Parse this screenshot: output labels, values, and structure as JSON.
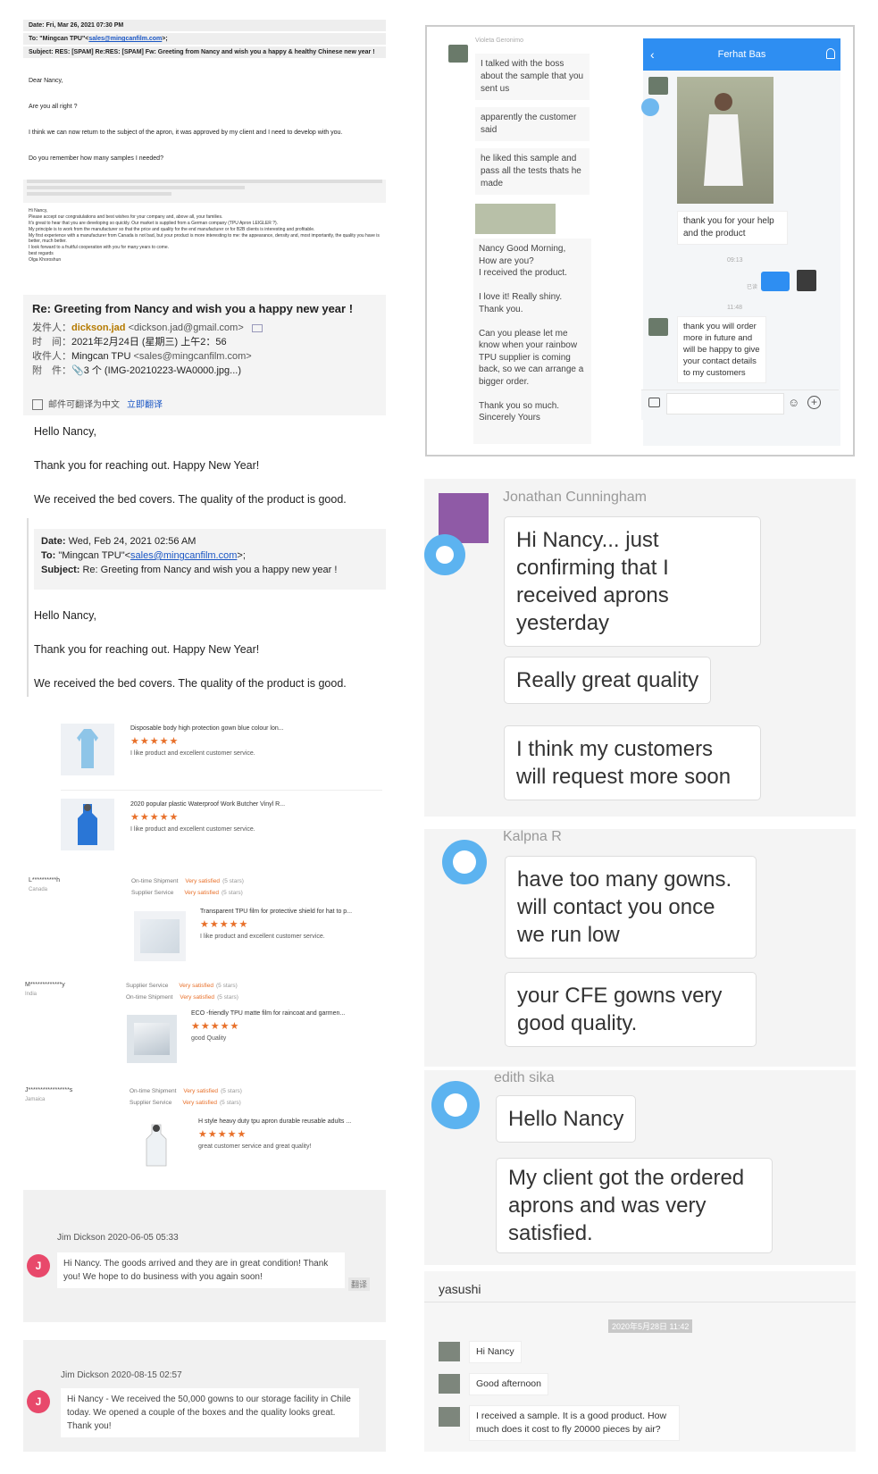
{
  "email1": {
    "date_line": "Date: Fri, Mar 26, 2021 07:30 PM",
    "to_prefix": "To: \"Mingcan TPU\"<",
    "to_email": "sales@mingcanfilm.com",
    "to_suffix": ">;",
    "subject_line": "Subject: RES: [SPAM] Re:RES: [SPAM] Fw: Greeting from Nancy and wish you a happy & healthy Chinese new year !",
    "greeting": "Dear Nancy,",
    "line1": "Are you all right ?",
    "line2": "I think we can now return to the subject of the apron, it was approved by my client and I need to develop with you.",
    "line3": "Do you remember how many samples I needed?",
    "tiny_lines": [
      "Hi Nancy,",
      "Please accept our congratulations and best wishes for your company and, above all, your families.",
      "It's great to hear that you are developing so quickly. Our market is supplied from a German company (TPU Apron LEIGLER ?).",
      "My principle is to work from the manufacturer so that the price and quality for the end manufacturer or for B2B clients is interesting and profitable.",
      "My first experience with a manufacturer from Canada is not bad, but your product is more interesting to me: the appearance, density and, most importantly, the quality you have is better, much better.",
      "I look forward to a fruitful cooperation with you for many years to come.",
      "best regards",
      "Olga Khoroshun"
    ]
  },
  "email2": {
    "subject": "Re: Greeting from Nancy and wish you a happy new year !",
    "from_label": "发件人：",
    "from_name": "dickson.jad",
    "from_email": "<dickson.jad@gmail.com>",
    "time_label": "时　间：",
    "time_value": "2021年2月24日 (星期三) 上午2：56",
    "to_label": "收件人：",
    "to_name": "Mingcan TPU",
    "to_email": "<sales@mingcanfilm.com>",
    "attach_label": "附　件：",
    "attach_value": "3 个 (IMG-20210223-WA0000.jpg...)",
    "translate_text": "邮件可翻译为中文",
    "translate_link": "立即翻译",
    "hello": "Hello Nancy,",
    "thanks": "Thank you for reaching out.  Happy New Year!",
    "received": "We received the bed covers.  The quality of the product is good."
  },
  "email3": {
    "date_label": "Date:",
    "date_value": " Wed, Feb 24, 2021 02:56 AM",
    "to_label": "To:",
    "to_prefix": " \"Mingcan TPU\"<",
    "to_email": "sales@mingcanfilm.com",
    "to_suffix": ">;",
    "subject_label": "Subject:",
    "subject_value": " Re: Greeting from Nancy and wish you a happy new year !",
    "hello": "Hello Nancy,",
    "thanks": "Thank you for reaching out.  Happy New Year!",
    "received": "We received the bed covers.  The quality of the product is good."
  },
  "reviews": {
    "r1_title": "Disposable body high protection gown blue colour lon...",
    "r1_comment": "I like product and excellent customer service.",
    "r2_title": "2020 popular plastic Waterproof Work Butcher Vinyl R...",
    "r2_comment": "I like product and excellent customer service.",
    "stars": "★★★★★",
    "b3_name": "L**********h",
    "b3_country": "Canada",
    "b3_svc1": "On-time Shipment",
    "b3_svc2": "Supplier Service",
    "very": "Very satisfied",
    "five": "(5 stars)",
    "r3_title": "Transparent TPU film for protective shield for hat to p...",
    "r3_comment": "I like product and excellent customer service.",
    "b4_name": "M*************y",
    "b4_country": "India",
    "b4_svc1": "Supplier Service",
    "b4_svc2": "On-time Shipment",
    "r4_title": "ECO -friendly TPU matte film for raincoat and garmen...",
    "r4_comment": "good Quality",
    "b5_name": "J*****************s",
    "b5_country": "Jamaica",
    "b5_svc1": "On-time Shipment",
    "b5_svc2": "Supplier Service",
    "r5_title": "H style heavy duty tpu apron durable reusable adults ...",
    "r5_comment": "great customer service and great quality!"
  },
  "jim": {
    "avatar_letter": "J",
    "msg1_header": "Jim Dickson   2020-06-05 05:33",
    "msg1_text": "Hi Nancy. The goods arrived and they are in great condition! Thank you! We hope to do business with you again soon!",
    "translate_badge": "翻译",
    "msg2_header": "Jim Dickson   2020-08-15 02:57",
    "msg2_text": "Hi Nancy - We received the 50,000 gowns to our storage facility in Chile today. We opened a couple of the boxes and the quality looks great. Thank you!"
  },
  "topchat": {
    "violeta_label": "Violeta Geronimo",
    "v1": "I talked with the boss about the sample that you sent us",
    "v2": "apparently the customer said",
    "v3": "he liked this sample and pass all the tests thats he made",
    "v4": "Nancy Good Morning,\nHow are you?\nI received the product.\n\nI love it! Really shiny.\nThank you.\n\nCan you please let me know when your rainbow TPU supplier is coming back, so we can arrange a bigger order.\n\nThank you so much.\nSincerely Yours",
    "ferhat_title": "Ferhat Bas",
    "f1": "thank you for your help and the product",
    "time1": "09:13",
    "read1": "已读",
    "time2": "11:48",
    "f2": "thank you will order more in future and will be happy to give your contact details to my customers"
  },
  "jonathan": {
    "name": "Jonathan  Cunningham",
    "b1": "Hi Nancy... just confirming that I received aprons yesterday",
    "b2": "Really great quality",
    "b3": "I think my customers will request more soon"
  },
  "kalpna": {
    "name": "Kalpna R",
    "b1": "have too many gowns. will contact you once we run low",
    "b2": "your CFE gowns very good quality."
  },
  "edith": {
    "name": "edith sika",
    "b1": "Hello Nancy",
    "b2": "My client got the ordered aprons and was very satisfied."
  },
  "yasushi": {
    "name": "yasushi",
    "timestamp": "2020年5月28日 11:42",
    "m1": "Hi Nancy",
    "m2": "Good afternoon",
    "m3": "I received a sample. It is a good product. How much does it cost to fly 20000 pieces by air?"
  },
  "colors": {
    "accent_blue": "#2e8ef2",
    "star_orange": "#e8702a",
    "avatar_pink": "#e8496b",
    "link_blue": "#1a56c4"
  }
}
